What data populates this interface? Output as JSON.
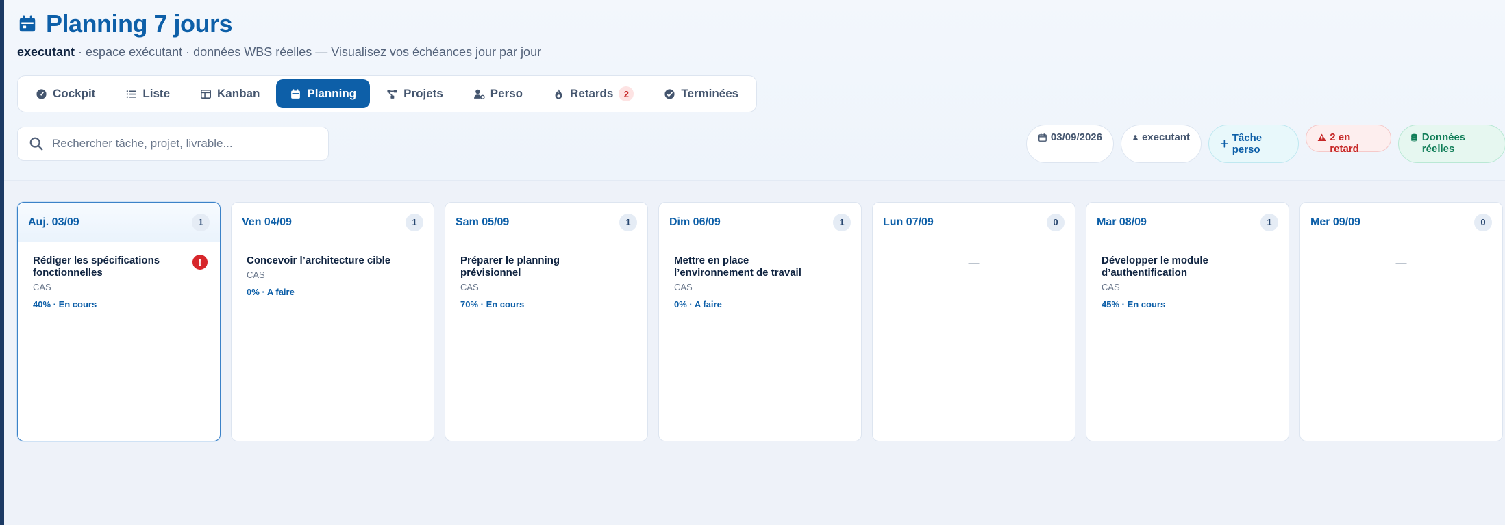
{
  "header": {
    "title": "Planning 7 jours",
    "subtitle_user": "executant",
    "subtitle_rest": " · espace exécutant · données WBS réelles — Visualisez vos échéances jour par jour"
  },
  "tabs": [
    {
      "label": "Cockpit",
      "icon": "gauge-icon"
    },
    {
      "label": "Liste",
      "icon": "list-icon"
    },
    {
      "label": "Kanban",
      "icon": "kanban-icon"
    },
    {
      "label": "Planning",
      "icon": "calendar-icon",
      "active": true
    },
    {
      "label": "Projets",
      "icon": "project-tree-icon"
    },
    {
      "label": "Perso",
      "icon": "user-gear-icon"
    },
    {
      "label": "Retards",
      "icon": "fire-icon",
      "count": "2"
    },
    {
      "label": "Terminées",
      "icon": "check-circle-icon"
    }
  ],
  "search": {
    "placeholder": "Rechercher tâche, projet, livrable..."
  },
  "chips": {
    "date": "03/09/2026",
    "user": "executant",
    "add": "Tâche perso",
    "late": "2 en retard",
    "real": "Données réelles"
  },
  "columns": [
    {
      "day": "Auj. 03/09",
      "count": "1",
      "today": true,
      "tasks": [
        {
          "title": "Rédiger les spécifications fonctionnelles",
          "project": "CAS",
          "status": "40% · En cours",
          "alert": "!"
        }
      ]
    },
    {
      "day": "Ven 04/09",
      "count": "1",
      "tasks": [
        {
          "title": "Concevoir l’architecture cible",
          "project": "CAS",
          "status": "0% · A faire"
        }
      ]
    },
    {
      "day": "Sam 05/09",
      "count": "1",
      "tasks": [
        {
          "title": "Préparer le planning prévisionnel",
          "project": "CAS",
          "status": "70% · En cours"
        }
      ]
    },
    {
      "day": "Dim 06/09",
      "count": "1",
      "tasks": [
        {
          "title": "Mettre en place l’environnement de travail",
          "project": "CAS",
          "status": "0% · A faire"
        }
      ]
    },
    {
      "day": "Lun 07/09",
      "count": "0",
      "tasks": [],
      "empty": "—"
    },
    {
      "day": "Mar 08/09",
      "count": "1",
      "tasks": [
        {
          "title": "Développer le module d’authentification",
          "project": "CAS",
          "status": "45% · En cours"
        }
      ]
    },
    {
      "day": "Mer 09/09",
      "count": "0",
      "tasks": [],
      "empty": "—"
    }
  ],
  "colors": {
    "accent": "#0d5fa8",
    "danger": "#c62828",
    "success": "#0f7d57"
  }
}
